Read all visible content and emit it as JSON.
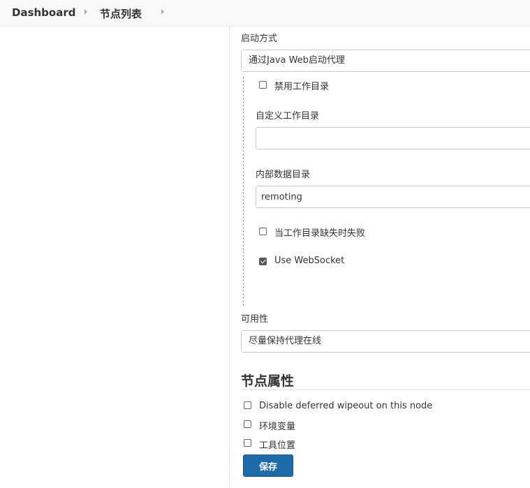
{
  "breadcrumb": {
    "items": [
      "Dashboard",
      "节点列表"
    ]
  },
  "launch": {
    "label": "启动方式",
    "selected": "通过Java Web启动代理"
  },
  "options": {
    "disable_workdir": {
      "label": "禁用工作目录",
      "checked": false
    },
    "custom_workdir": {
      "label": "自定义工作目录",
      "value": ""
    },
    "internal_data_dir": {
      "label": "内部数据目录",
      "value": "remoting"
    },
    "fail_if_missing": {
      "label": "当工作目录缺失时失败",
      "checked": false
    },
    "use_websocket": {
      "label": "Use WebSocket",
      "checked": true
    }
  },
  "availability": {
    "label": "可用性",
    "selected": "尽量保持代理在线"
  },
  "node_properties": {
    "title": "节点属性",
    "items": [
      {
        "label": "Disable deferred wipeout on this node",
        "checked": false
      },
      {
        "label": "环境变量",
        "checked": false
      },
      {
        "label": "工具位置",
        "checked": false
      }
    ]
  },
  "save_label": "保存",
  "colors": {
    "primary_button": "#1f6aa8",
    "topbar_bg": "#f8f8f8"
  }
}
